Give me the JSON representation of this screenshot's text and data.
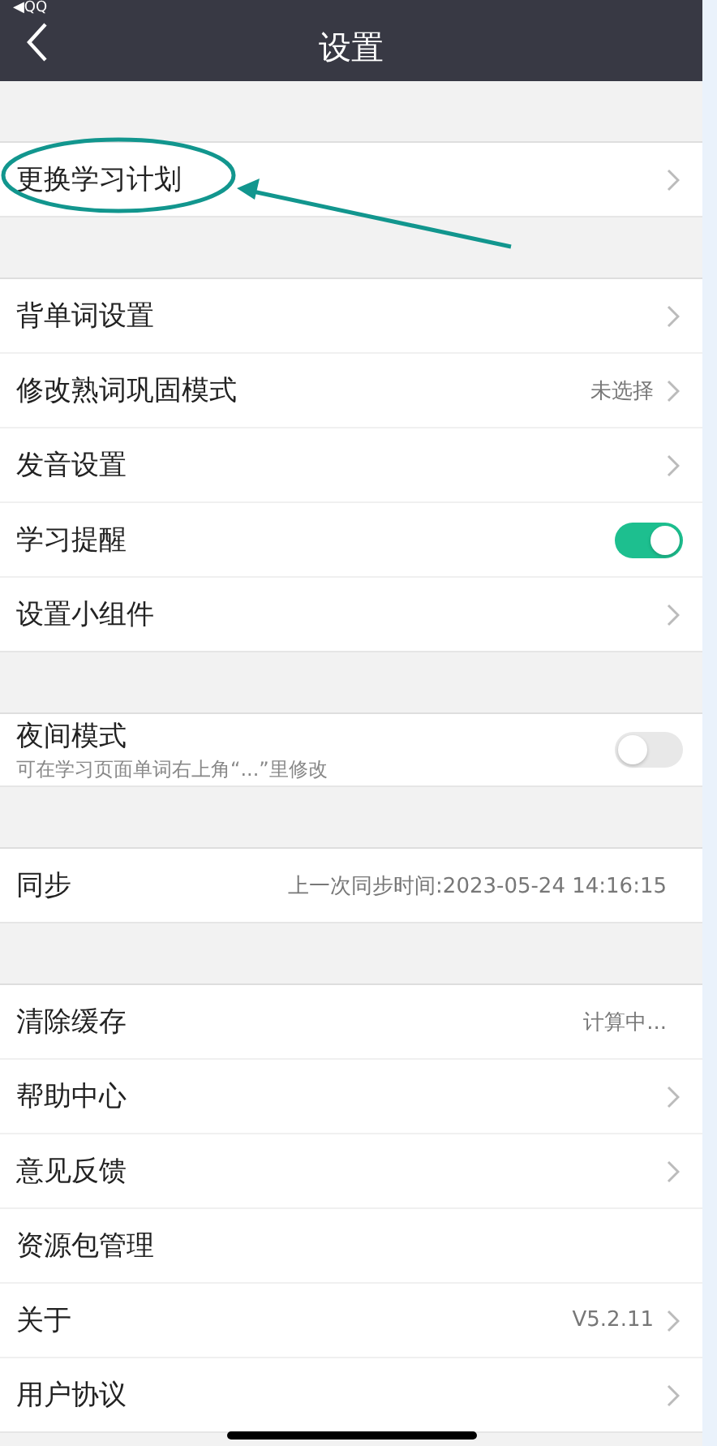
{
  "status_bar": {
    "back_app": "◀QQ"
  },
  "nav": {
    "title": "设置"
  },
  "groups": [
    {
      "items": [
        {
          "kind": "link",
          "label": "更换学习计划"
        }
      ]
    },
    {
      "items": [
        {
          "kind": "link",
          "label": "背单词设置"
        },
        {
          "kind": "link",
          "label": "修改熟词巩固模式",
          "value": "未选择"
        },
        {
          "kind": "link",
          "label": "发音设置"
        },
        {
          "kind": "toggle",
          "label": "学习提醒",
          "on": true
        },
        {
          "kind": "link",
          "label": "设置小组件"
        }
      ]
    },
    {
      "items": [
        {
          "kind": "toggle",
          "label": "夜间模式",
          "subtitle": "可在学习页面单词右上角“...”里修改",
          "on": false
        }
      ]
    },
    {
      "items": [
        {
          "kind": "info",
          "label": "同步",
          "value": "上一次同步时间:2023-05-24 14:16:15"
        }
      ]
    },
    {
      "items": [
        {
          "kind": "info",
          "label": "清除缓存",
          "value": "计算中..."
        },
        {
          "kind": "link",
          "label": "帮助中心"
        },
        {
          "kind": "link",
          "label": "意见反馈"
        },
        {
          "kind": "info",
          "label": "资源包管理"
        },
        {
          "kind": "link",
          "label": "关于",
          "value": "V5.2.11"
        },
        {
          "kind": "link",
          "label": "用户协议"
        }
      ]
    }
  ]
}
